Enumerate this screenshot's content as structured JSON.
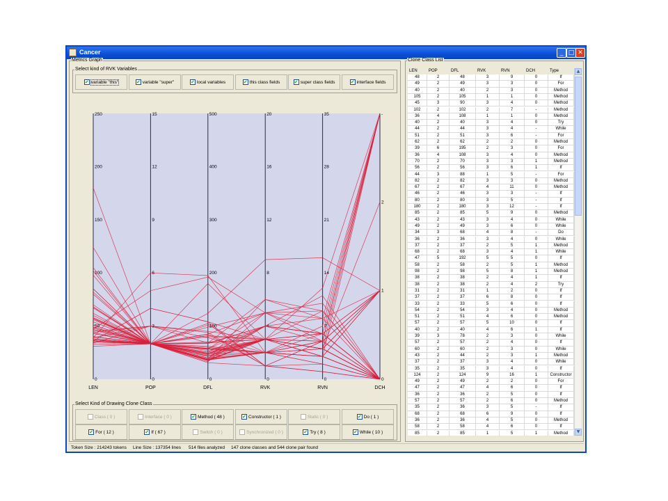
{
  "window": {
    "title": "Cancer",
    "btn_min": "_",
    "btn_max": "□",
    "btn_close": "✕"
  },
  "metrics_graph": {
    "panel_title": "Metrics Graph",
    "rvk_group_title": "Select kind of RVK Variables",
    "rvk_options": [
      {
        "label": "variable \"this\"",
        "checked": true
      },
      {
        "label": "variable \"super\"",
        "checked": true
      },
      {
        "label": "local variables",
        "checked": true
      },
      {
        "label": "this class fields",
        "checked": true
      },
      {
        "label": "super class fields",
        "checked": true
      },
      {
        "label": "interface fields",
        "checked": true
      }
    ],
    "axes": [
      {
        "name": "LEN",
        "ticks": [
          "250",
          "200",
          "150",
          "100",
          "50",
          "0"
        ]
      },
      {
        "name": "POP",
        "ticks": [
          "15",
          "12",
          "9",
          "6",
          "3",
          "0"
        ]
      },
      {
        "name": "DFL",
        "ticks": [
          "500",
          "400",
          "300",
          "200",
          "100",
          "0"
        ]
      },
      {
        "name": "RVK",
        "ticks": [
          "20",
          "16",
          "12",
          "8",
          "4",
          "0"
        ]
      },
      {
        "name": "RVN",
        "ticks": [
          "35",
          "28",
          "21",
          "14",
          "7",
          "0"
        ]
      },
      {
        "name": "DCH",
        "ticks": [
          "-",
          "2",
          "1",
          "0"
        ]
      }
    ],
    "line_color": "#d8203a",
    "plot_bg": "#d4d7ec",
    "draw_group_title": "Select Kind of Drawing Clone Class",
    "draw_options": [
      {
        "label": "Class ( 0 )",
        "checked": false,
        "enabled": false
      },
      {
        "label": "Interface ( 0 )",
        "checked": false,
        "enabled": false
      },
      {
        "label": "Method ( 48 )",
        "checked": true,
        "enabled": true
      },
      {
        "label": "Constructor ( 1 )",
        "checked": true,
        "enabled": true
      },
      {
        "label": "Static ( 0 )",
        "checked": false,
        "enabled": false
      },
      {
        "label": "Do ( 1 )",
        "checked": true,
        "enabled": true
      },
      {
        "label": "For ( 12 )",
        "checked": true,
        "enabled": true
      },
      {
        "label": "If ( 67 )",
        "checked": true,
        "enabled": true
      },
      {
        "label": "Switch ( 0 )",
        "checked": false,
        "enabled": false
      },
      {
        "label": "Synchronized ( 0 )",
        "checked": false,
        "enabled": false
      },
      {
        "label": "Try ( 8 )",
        "checked": true,
        "enabled": true
      },
      {
        "label": "While ( 10 )",
        "checked": true,
        "enabled": true
      }
    ]
  },
  "clone_list": {
    "panel_title": "Clone Class List",
    "columns": [
      "LEN",
      "POP",
      "DFL",
      "RVK",
      "RVN",
      "DCH",
      "Type"
    ],
    "rows": [
      [
        "48",
        "2",
        "48",
        "3",
        "9",
        "0",
        "If"
      ],
      [
        "49",
        "2",
        "49",
        "3",
        "3",
        "0",
        "For"
      ],
      [
        "40",
        "2",
        "40",
        "2",
        "3",
        "0",
        "Method"
      ],
      [
        "105",
        "2",
        "105",
        "1",
        "1",
        "0",
        "Method"
      ],
      [
        "45",
        "3",
        "90",
        "3",
        "4",
        "0",
        "Method"
      ],
      [
        "102",
        "2",
        "102",
        "2",
        "7",
        "-",
        "Method"
      ],
      [
        "36",
        "4",
        "108",
        "1",
        "1",
        "0",
        "Method"
      ],
      [
        "40",
        "2",
        "40",
        "3",
        "4",
        "0",
        "Try"
      ],
      [
        "44",
        "2",
        "44",
        "3",
        "4",
        "-",
        "While"
      ],
      [
        "51",
        "2",
        "51",
        "3",
        "6",
        "-",
        "For"
      ],
      [
        "62",
        "2",
        "62",
        "2",
        "2",
        "0",
        "Method"
      ],
      [
        "39",
        "6",
        "195",
        "2",
        "3",
        "0",
        "For"
      ],
      [
        "36",
        "4",
        "108",
        "3",
        "4",
        "0",
        "Method"
      ],
      [
        "70",
        "2",
        "70",
        "3",
        "3",
        "1",
        "Method"
      ],
      [
        "56",
        "2",
        "56",
        "3",
        "6",
        "1",
        "If"
      ],
      [
        "44",
        "3",
        "88",
        "1",
        "5",
        "-",
        "For"
      ],
      [
        "82",
        "2",
        "82",
        "3",
        "3",
        "0",
        "Method"
      ],
      [
        "67",
        "2",
        "67",
        "4",
        "11",
        "0",
        "Method"
      ],
      [
        "46",
        "2",
        "46",
        "3",
        "3",
        "-",
        "If"
      ],
      [
        "80",
        "2",
        "80",
        "3",
        "5",
        "-",
        "If"
      ],
      [
        "180",
        "2",
        "180",
        "3",
        "12",
        "-",
        "If"
      ],
      [
        "85",
        "2",
        "85",
        "5",
        "9",
        "0",
        "Method"
      ],
      [
        "43",
        "2",
        "43",
        "3",
        "4",
        "0",
        "While"
      ],
      [
        "49",
        "2",
        "49",
        "3",
        "6",
        "0",
        "While"
      ],
      [
        "34",
        "3",
        "68",
        "4",
        "8",
        "-",
        "Do"
      ],
      [
        "36",
        "2",
        "36",
        "3",
        "4",
        "0",
        "While"
      ],
      [
        "37",
        "2",
        "37",
        "2",
        "5",
        "1",
        "Method"
      ],
      [
        "68",
        "2",
        "68",
        "3",
        "4",
        "1",
        "While"
      ],
      [
        "47",
        "5",
        "192",
        "5",
        "5",
        "0",
        "If"
      ],
      [
        "58",
        "2",
        "58",
        "2",
        "5",
        "1",
        "Method"
      ],
      [
        "98",
        "2",
        "98",
        "5",
        "8",
        "1",
        "Method"
      ],
      [
        "38",
        "2",
        "38",
        "2",
        "4",
        "1",
        "If"
      ],
      [
        "38",
        "2",
        "38",
        "2",
        "4",
        "2",
        "Try"
      ],
      [
        "31",
        "2",
        "31",
        "1",
        "2",
        "0",
        "If"
      ],
      [
        "37",
        "2",
        "37",
        "6",
        "8",
        "0",
        "If"
      ],
      [
        "33",
        "2",
        "33",
        "5",
        "6",
        "0",
        "If"
      ],
      [
        "54",
        "2",
        "54",
        "3",
        "4",
        "0",
        "Method"
      ],
      [
        "51",
        "2",
        "51",
        "4",
        "6",
        "0",
        "Method"
      ],
      [
        "57",
        "2",
        "57",
        "5",
        "10",
        "0",
        "If"
      ],
      [
        "40",
        "2",
        "40",
        "4",
        "6",
        "1",
        "If"
      ],
      [
        "39",
        "3",
        "78",
        "2",
        "3",
        "0",
        "While"
      ],
      [
        "57",
        "2",
        "57",
        "2",
        "4",
        "0",
        "If"
      ],
      [
        "60",
        "2",
        "60",
        "2",
        "3",
        "0",
        "While"
      ],
      [
        "43",
        "2",
        "44",
        "2",
        "3",
        "1",
        "Method"
      ],
      [
        "37",
        "2",
        "37",
        "3",
        "4",
        "0",
        "While"
      ],
      [
        "35",
        "2",
        "35",
        "3",
        "4",
        "0",
        "If"
      ],
      [
        "124",
        "2",
        "124",
        "9",
        "16",
        "1",
        "Constructor"
      ],
      [
        "49",
        "2",
        "49",
        "2",
        "2",
        "0",
        "For"
      ],
      [
        "47",
        "2",
        "47",
        "4",
        "6",
        "0",
        "If"
      ],
      [
        "36",
        "2",
        "36",
        "2",
        "5",
        "0",
        "If"
      ],
      [
        "57",
        "2",
        "57",
        "2",
        "6",
        "0",
        "Method"
      ],
      [
        "35",
        "2",
        "36",
        "3",
        "5",
        "-",
        "If"
      ],
      [
        "68",
        "2",
        "68",
        "6",
        "9",
        "0",
        "If"
      ],
      [
        "36",
        "2",
        "36",
        "4",
        "5",
        "0",
        "Method"
      ],
      [
        "58",
        "2",
        "58",
        "4",
        "6",
        "0",
        "If"
      ],
      [
        "85",
        "2",
        "85",
        "1",
        "5",
        "1",
        "Method"
      ]
    ]
  },
  "status": {
    "token_size": "Token Size : 214243 tokens",
    "line_size": "Line Size : 137354 lines",
    "files": "514 files analyzed",
    "summary": "147 clone classes and 544 clone pair found"
  }
}
